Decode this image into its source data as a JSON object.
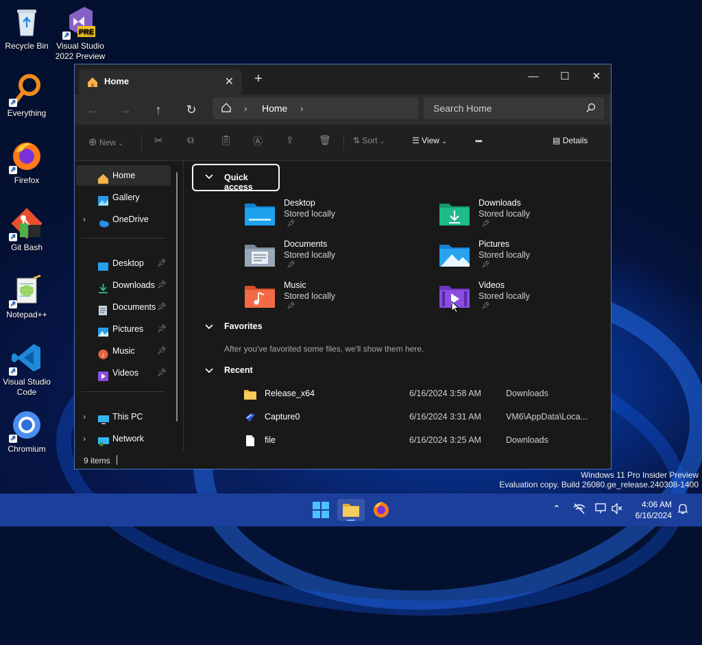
{
  "desktop": {
    "icons": [
      {
        "label": "Recycle Bin",
        "icon": "recycle-bin-icon"
      },
      {
        "label": "Visual Studio 2022 Preview",
        "line1": "Visual Studio",
        "line2": "2022 Preview",
        "badge": "PRE",
        "icon": "visual-studio-icon"
      },
      {
        "label": "Everything",
        "icon": "everything-icon"
      },
      {
        "label": "Firefox",
        "icon": "firefox-icon"
      },
      {
        "label": "Git Bash",
        "icon": "git-bash-icon"
      },
      {
        "label": "Notepad++",
        "icon": "notepadpp-icon"
      },
      {
        "label": "Visual Studio Code",
        "line1": "Visual Studio",
        "line2": "Code",
        "icon": "vscode-icon"
      },
      {
        "label": "Chromium",
        "icon": "chromium-icon"
      }
    ],
    "watermark": {
      "line1": "Windows 11 Pro Insider Preview",
      "line2": "Evaluation copy. Build 26080.ge_release.240308-1400"
    }
  },
  "explorer": {
    "tab": {
      "title": "Home",
      "close": "✕",
      "new_tab": "+"
    },
    "window_controls": {
      "minimize": "—",
      "maximize": "☐",
      "close": "✕"
    },
    "address": {
      "crumb": "Home",
      "search_placeholder": "Search Home"
    },
    "commands": {
      "new": "New",
      "sort": "Sort",
      "view": "View",
      "more": "•••",
      "details": "Details"
    },
    "sidebar": {
      "home": "Home",
      "gallery": "Gallery",
      "onedrive": "OneDrive",
      "pinned": [
        {
          "label": "Desktop",
          "icon": "desktop-folder-icon"
        },
        {
          "label": "Downloads",
          "icon": "downloads-folder-icon"
        },
        {
          "label": "Documents",
          "icon": "documents-folder-icon"
        },
        {
          "label": "Pictures",
          "icon": "pictures-folder-icon"
        },
        {
          "label": "Music",
          "icon": "music-folder-icon"
        },
        {
          "label": "Videos",
          "icon": "videos-folder-icon"
        }
      ],
      "this_pc": "This PC",
      "network": "Network"
    },
    "quick_access": {
      "title": "Quick access",
      "folders": [
        {
          "name": "Desktop",
          "status": "Stored locally",
          "color": "#1ea2f0"
        },
        {
          "name": "Downloads",
          "status": "Stored locally",
          "color": "#1fb98a"
        },
        {
          "name": "Documents",
          "status": "Stored locally",
          "color": "#9aa7b8"
        },
        {
          "name": "Pictures",
          "status": "Stored locally",
          "color": "#27a3f0"
        },
        {
          "name": "Music",
          "status": "Stored locally",
          "color": "#f26b45"
        },
        {
          "name": "Videos",
          "status": "Stored locally",
          "color": "#8a4de0"
        }
      ]
    },
    "favorites": {
      "title": "Favorites",
      "hint": "After you've favorited some files, we'll show them here."
    },
    "recent": {
      "title": "Recent",
      "items": [
        {
          "name": "Release_x64",
          "date": "6/16/2024 3:58 AM",
          "location": "Downloads",
          "icon": "folder-icon"
        },
        {
          "name": "Capture0",
          "date": "6/16/2024 3:31 AM",
          "location": "VM6\\AppData\\Loca...",
          "icon": "capture-file-icon"
        },
        {
          "name": "file",
          "date": "6/16/2024 3:25 AM",
          "location": "Downloads",
          "icon": "file-icon"
        }
      ]
    },
    "status": {
      "items": "9 items"
    }
  },
  "taskbar": {
    "time": "4:06 AM",
    "date": "6/16/2024",
    "accent": "#1c3f9c"
  }
}
